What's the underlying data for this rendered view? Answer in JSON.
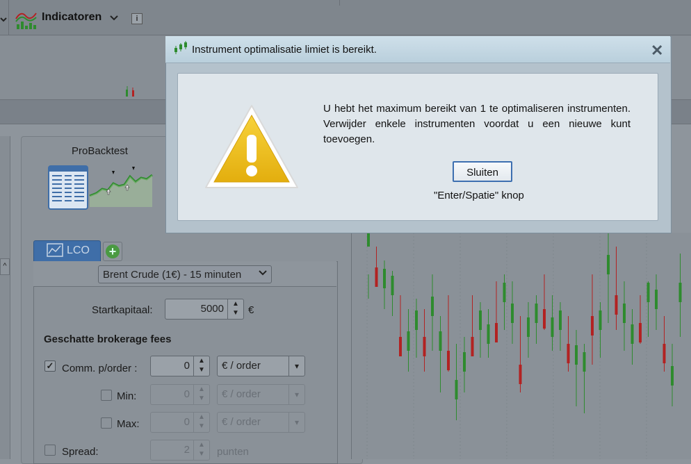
{
  "toolbar": {
    "indicators_label": "Indicatoren",
    "info_icon": "info-icon"
  },
  "backtest": {
    "title": "ProBacktest",
    "tab_label": "LCO",
    "instrument_select": "Brent Crude (1€) - 15 minuten",
    "start_capital_label": "Startkapitaal:",
    "start_capital_value": "5000",
    "currency": "€",
    "fees_heading": "Geschatte brokerage fees",
    "comm_label": "Comm. p/order :",
    "comm_value": "0",
    "comm_unit": "€ / order",
    "comm_checked": true,
    "min_label": "Min:",
    "min_value": "0",
    "min_unit": "€ / order",
    "max_label": "Max:",
    "max_value": "0",
    "max_unit": "€ / order",
    "spread_label": "Spread:",
    "spread_value": "2",
    "spread_unit": "punten"
  },
  "dialog": {
    "title": "Instrument optimalisatie limiet is bereikt.",
    "message": "U hebt het maximum bereikt van 1 te optimaliseren instrumenten. Verwijder enkele instrumenten voordat u een nieuwe kunt toevoegen.",
    "button_label": "Sluiten",
    "hint": "\"Enter/Spatie\" knop"
  },
  "colors": {
    "bull": "#2e8b2e",
    "bear": "#b22222",
    "dialog_bg": "#dfe6eb",
    "accent": "#3d6fb0"
  }
}
